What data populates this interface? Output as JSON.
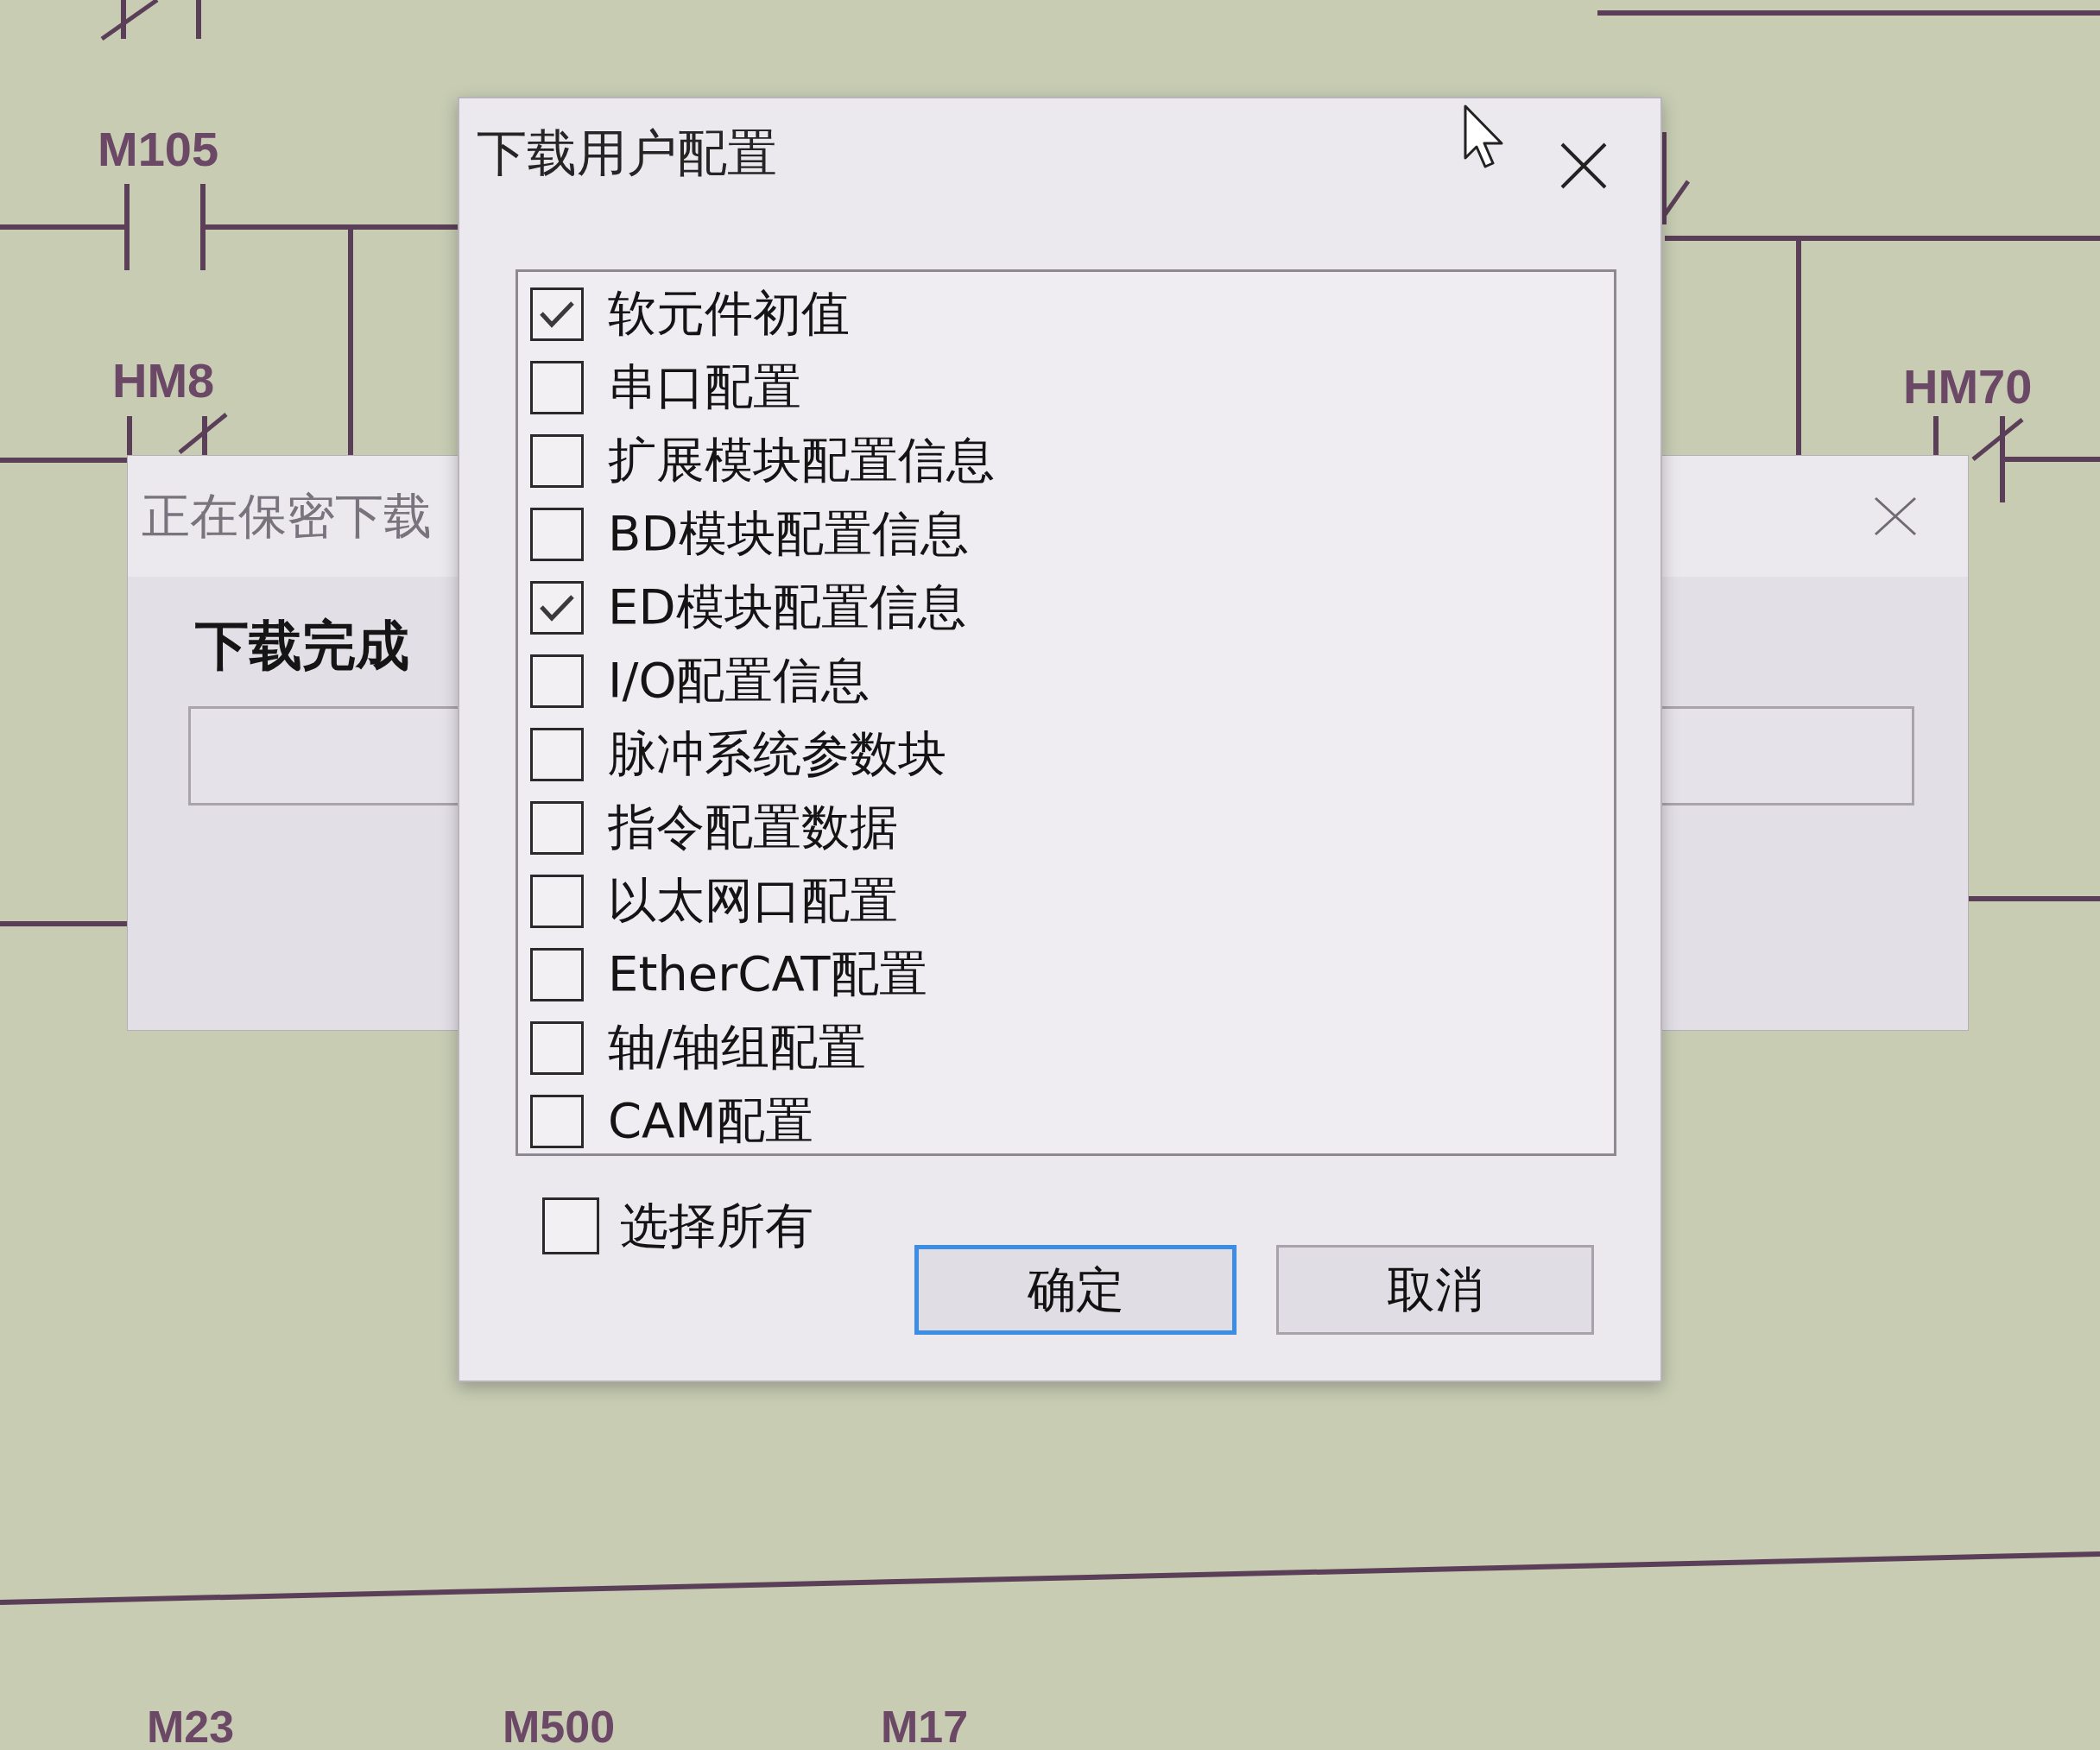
{
  "ladder": {
    "contacts": [
      {
        "kind": "closed"
      },
      {
        "label": "M105",
        "kind": "open"
      },
      {
        "label": "HM8",
        "kind": "closed"
      },
      {
        "kind": "closed"
      },
      {
        "label": "HM70",
        "kind": "closed"
      }
    ],
    "labels": [
      "M23",
      "M500",
      "M17"
    ]
  },
  "back_dialog": {
    "title": "正在保密下载",
    "message": "下载完成",
    "progress": {
      "level": 0
    }
  },
  "dialog": {
    "title": "下载用户配置",
    "items": [
      {
        "label": "软元件初值",
        "checked": true
      },
      {
        "label": "串口配置",
        "checked": false
      },
      {
        "label": "扩展模块配置信息",
        "checked": false
      },
      {
        "label": "BD模块配置信息",
        "checked": false
      },
      {
        "label": "ED模块配置信息",
        "checked": true
      },
      {
        "label": "I/O配置信息",
        "checked": false
      },
      {
        "label": "脉冲系统参数块",
        "checked": false
      },
      {
        "label": "指令配置数据",
        "checked": false
      },
      {
        "label": "以太网口配置",
        "checked": false
      },
      {
        "label": "EtherCAT配置",
        "checked": false
      },
      {
        "label": "轴/轴组配置",
        "checked": false
      },
      {
        "label": "CAM配置",
        "checked": false
      }
    ],
    "select_all": {
      "label": "选择所有",
      "checked": false
    },
    "buttons": [
      {
        "label": "确定",
        "focused": true
      },
      {
        "label": "取消",
        "focused": false
      }
    ]
  }
}
